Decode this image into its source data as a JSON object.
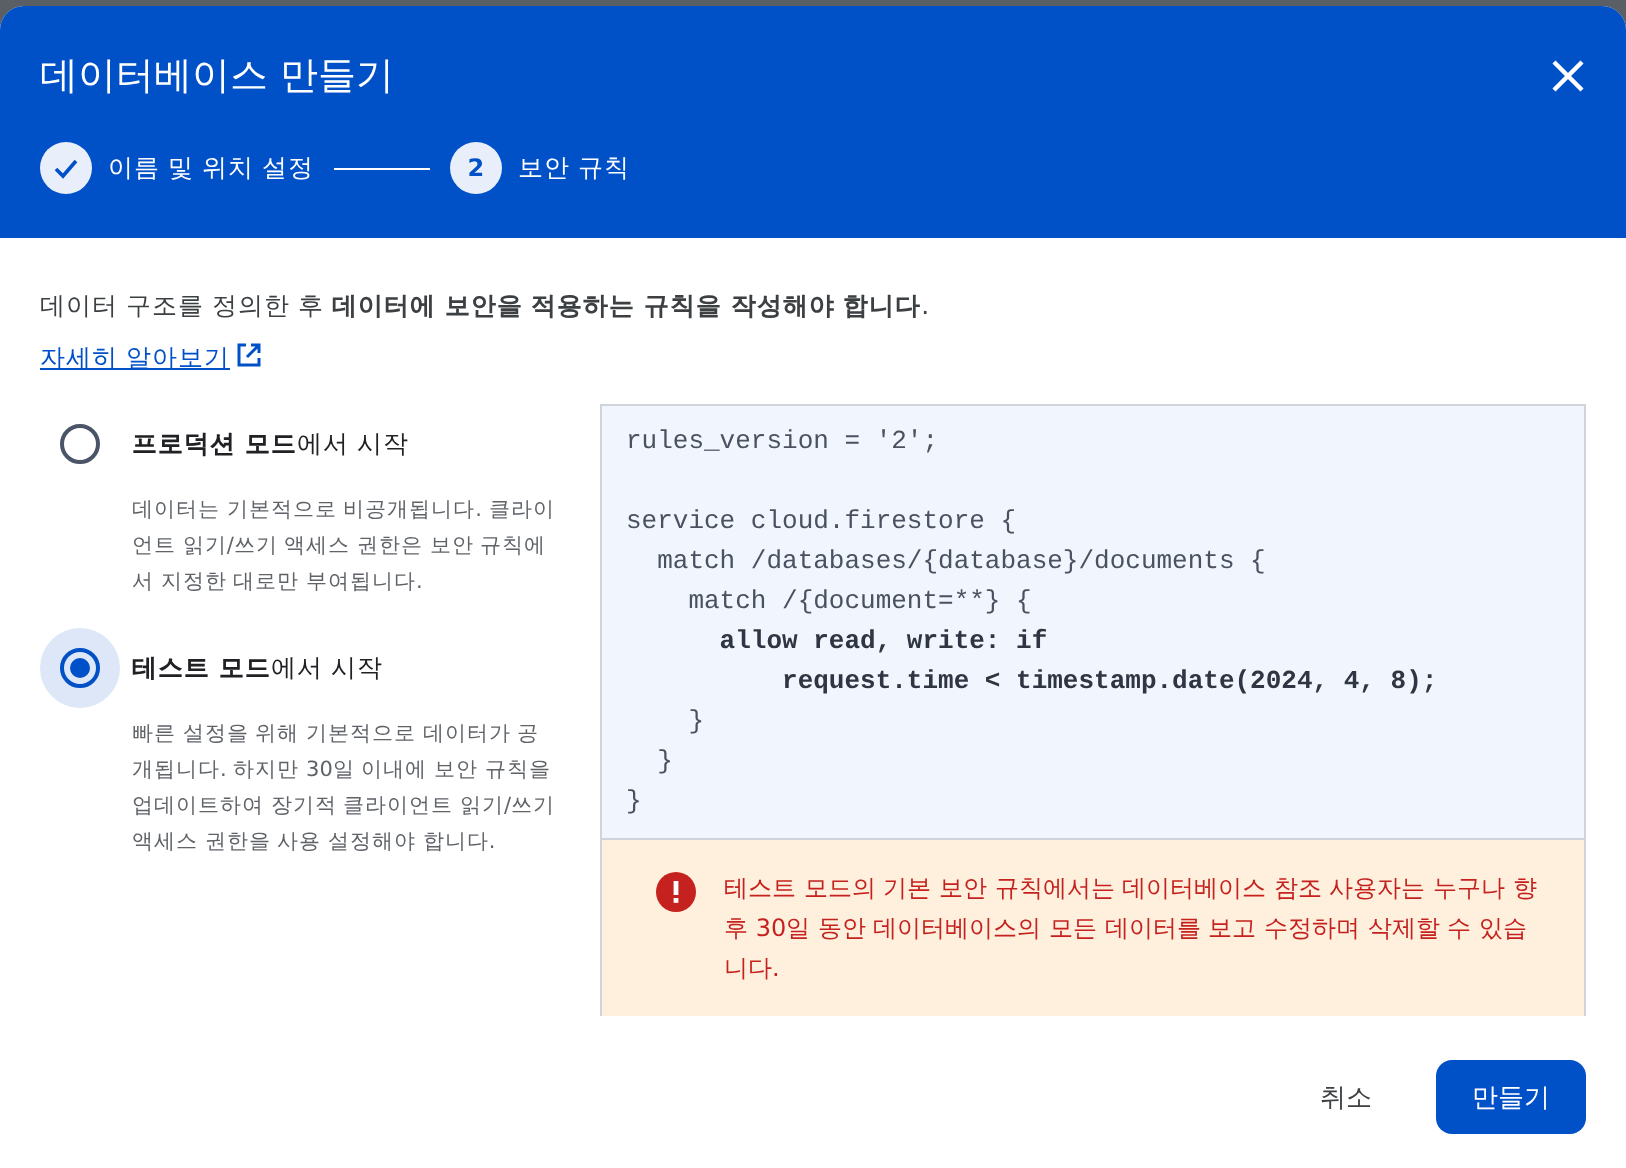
{
  "dialog": {
    "title": "데이터베이스 만들기"
  },
  "steps": [
    {
      "label": "이름 및 위치 설정",
      "completed": true
    },
    {
      "label": "보안 규칙",
      "completed": false,
      "number": "2"
    }
  ],
  "intro": "데이터 구조를 정의한 후 **데이터에 보안을 적용하는 규칙을 작성해야 합니다**.",
  "learn_more_link": "자세히 알아보기",
  "modes": [
    {
      "label": "**프로덕션 모드**에서 시작",
      "description": "데이터는 기본적으로 비공개됩니다. 클라이언트 읽기/쓰기 액세스 권한은 보안 규칙에서 지정한 대로만 부여됩니다.",
      "selected": false
    },
    {
      "label": "**테스트 모드**에서 시작",
      "description": "빠른 설정을 위해 기본적으로 데이터가 공개됩니다. 하지만 30일 이내에 보안 규칙을 업데이트하여 장기적 클라이언트 읽기/쓰기 액세스 권한을 사용 설정해야 합니다.",
      "selected": true
    }
  ],
  "code_blocks": [
    [
      {
        "text": "rules_version = '2';",
        "bold": false
      }
    ],
    [
      {
        "text": "service cloud.firestore {",
        "bold": false
      },
      {
        "text": "  match /databases/{database}/documents {",
        "bold": false
      },
      {
        "text": "    match /{document=**} {",
        "bold": false
      },
      {
        "text": "      allow read, write: if",
        "bold": true
      },
      {
        "text": "          request.time < timestamp.date(2024, 4, 8);",
        "bold": true
      },
      {
        "text": "    }",
        "bold": false
      },
      {
        "text": "  }",
        "bold": false
      },
      {
        "text": "}",
        "bold": false
      }
    ]
  ],
  "warning": "테스트 모드의 기본 보안 규칙에서는 데이터베이스 참조 사용자는 누구나 향후 30일 동안 데이터베이스의 모든 데이터를 보고 수정하며 삭제할 수 있습니다.",
  "buttons": [
    {
      "label": "취소",
      "kind": "text"
    },
    {
      "label": "만들기",
      "kind": "primary"
    }
  ]
}
